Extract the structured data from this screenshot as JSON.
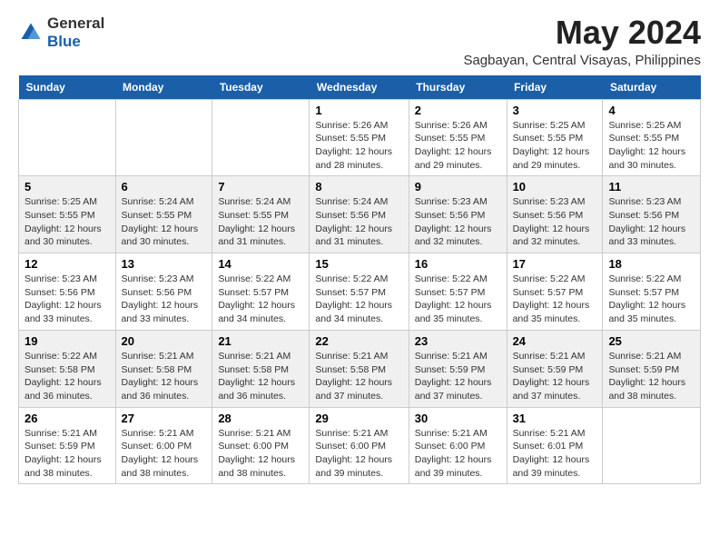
{
  "logo": {
    "text_general": "General",
    "text_blue": "Blue"
  },
  "header": {
    "month_title": "May 2024",
    "location": "Sagbayan, Central Visayas, Philippines"
  },
  "weekdays": [
    "Sunday",
    "Monday",
    "Tuesday",
    "Wednesday",
    "Thursday",
    "Friday",
    "Saturday"
  ],
  "weeks": [
    [
      {
        "day": "",
        "sunrise": "",
        "sunset": "",
        "daylight": ""
      },
      {
        "day": "",
        "sunrise": "",
        "sunset": "",
        "daylight": ""
      },
      {
        "day": "",
        "sunrise": "",
        "sunset": "",
        "daylight": ""
      },
      {
        "day": "1",
        "sunrise": "Sunrise: 5:26 AM",
        "sunset": "Sunset: 5:55 PM",
        "daylight": "Daylight: 12 hours and 28 minutes."
      },
      {
        "day": "2",
        "sunrise": "Sunrise: 5:26 AM",
        "sunset": "Sunset: 5:55 PM",
        "daylight": "Daylight: 12 hours and 29 minutes."
      },
      {
        "day": "3",
        "sunrise": "Sunrise: 5:25 AM",
        "sunset": "Sunset: 5:55 PM",
        "daylight": "Daylight: 12 hours and 29 minutes."
      },
      {
        "day": "4",
        "sunrise": "Sunrise: 5:25 AM",
        "sunset": "Sunset: 5:55 PM",
        "daylight": "Daylight: 12 hours and 30 minutes."
      }
    ],
    [
      {
        "day": "5",
        "sunrise": "Sunrise: 5:25 AM",
        "sunset": "Sunset: 5:55 PM",
        "daylight": "Daylight: 12 hours and 30 minutes."
      },
      {
        "day": "6",
        "sunrise": "Sunrise: 5:24 AM",
        "sunset": "Sunset: 5:55 PM",
        "daylight": "Daylight: 12 hours and 30 minutes."
      },
      {
        "day": "7",
        "sunrise": "Sunrise: 5:24 AM",
        "sunset": "Sunset: 5:55 PM",
        "daylight": "Daylight: 12 hours and 31 minutes."
      },
      {
        "day": "8",
        "sunrise": "Sunrise: 5:24 AM",
        "sunset": "Sunset: 5:56 PM",
        "daylight": "Daylight: 12 hours and 31 minutes."
      },
      {
        "day": "9",
        "sunrise": "Sunrise: 5:23 AM",
        "sunset": "Sunset: 5:56 PM",
        "daylight": "Daylight: 12 hours and 32 minutes."
      },
      {
        "day": "10",
        "sunrise": "Sunrise: 5:23 AM",
        "sunset": "Sunset: 5:56 PM",
        "daylight": "Daylight: 12 hours and 32 minutes."
      },
      {
        "day": "11",
        "sunrise": "Sunrise: 5:23 AM",
        "sunset": "Sunset: 5:56 PM",
        "daylight": "Daylight: 12 hours and 33 minutes."
      }
    ],
    [
      {
        "day": "12",
        "sunrise": "Sunrise: 5:23 AM",
        "sunset": "Sunset: 5:56 PM",
        "daylight": "Daylight: 12 hours and 33 minutes."
      },
      {
        "day": "13",
        "sunrise": "Sunrise: 5:23 AM",
        "sunset": "Sunset: 5:56 PM",
        "daylight": "Daylight: 12 hours and 33 minutes."
      },
      {
        "day": "14",
        "sunrise": "Sunrise: 5:22 AM",
        "sunset": "Sunset: 5:57 PM",
        "daylight": "Daylight: 12 hours and 34 minutes."
      },
      {
        "day": "15",
        "sunrise": "Sunrise: 5:22 AM",
        "sunset": "Sunset: 5:57 PM",
        "daylight": "Daylight: 12 hours and 34 minutes."
      },
      {
        "day": "16",
        "sunrise": "Sunrise: 5:22 AM",
        "sunset": "Sunset: 5:57 PM",
        "daylight": "Daylight: 12 hours and 35 minutes."
      },
      {
        "day": "17",
        "sunrise": "Sunrise: 5:22 AM",
        "sunset": "Sunset: 5:57 PM",
        "daylight": "Daylight: 12 hours and 35 minutes."
      },
      {
        "day": "18",
        "sunrise": "Sunrise: 5:22 AM",
        "sunset": "Sunset: 5:57 PM",
        "daylight": "Daylight: 12 hours and 35 minutes."
      }
    ],
    [
      {
        "day": "19",
        "sunrise": "Sunrise: 5:22 AM",
        "sunset": "Sunset: 5:58 PM",
        "daylight": "Daylight: 12 hours and 36 minutes."
      },
      {
        "day": "20",
        "sunrise": "Sunrise: 5:21 AM",
        "sunset": "Sunset: 5:58 PM",
        "daylight": "Daylight: 12 hours and 36 minutes."
      },
      {
        "day": "21",
        "sunrise": "Sunrise: 5:21 AM",
        "sunset": "Sunset: 5:58 PM",
        "daylight": "Daylight: 12 hours and 36 minutes."
      },
      {
        "day": "22",
        "sunrise": "Sunrise: 5:21 AM",
        "sunset": "Sunset: 5:58 PM",
        "daylight": "Daylight: 12 hours and 37 minutes."
      },
      {
        "day": "23",
        "sunrise": "Sunrise: 5:21 AM",
        "sunset": "Sunset: 5:59 PM",
        "daylight": "Daylight: 12 hours and 37 minutes."
      },
      {
        "day": "24",
        "sunrise": "Sunrise: 5:21 AM",
        "sunset": "Sunset: 5:59 PM",
        "daylight": "Daylight: 12 hours and 37 minutes."
      },
      {
        "day": "25",
        "sunrise": "Sunrise: 5:21 AM",
        "sunset": "Sunset: 5:59 PM",
        "daylight": "Daylight: 12 hours and 38 minutes."
      }
    ],
    [
      {
        "day": "26",
        "sunrise": "Sunrise: 5:21 AM",
        "sunset": "Sunset: 5:59 PM",
        "daylight": "Daylight: 12 hours and 38 minutes."
      },
      {
        "day": "27",
        "sunrise": "Sunrise: 5:21 AM",
        "sunset": "Sunset: 6:00 PM",
        "daylight": "Daylight: 12 hours and 38 minutes."
      },
      {
        "day": "28",
        "sunrise": "Sunrise: 5:21 AM",
        "sunset": "Sunset: 6:00 PM",
        "daylight": "Daylight: 12 hours and 38 minutes."
      },
      {
        "day": "29",
        "sunrise": "Sunrise: 5:21 AM",
        "sunset": "Sunset: 6:00 PM",
        "daylight": "Daylight: 12 hours and 39 minutes."
      },
      {
        "day": "30",
        "sunrise": "Sunrise: 5:21 AM",
        "sunset": "Sunset: 6:00 PM",
        "daylight": "Daylight: 12 hours and 39 minutes."
      },
      {
        "day": "31",
        "sunrise": "Sunrise: 5:21 AM",
        "sunset": "Sunset: 6:01 PM",
        "daylight": "Daylight: 12 hours and 39 minutes."
      },
      {
        "day": "",
        "sunrise": "",
        "sunset": "",
        "daylight": ""
      }
    ]
  ]
}
